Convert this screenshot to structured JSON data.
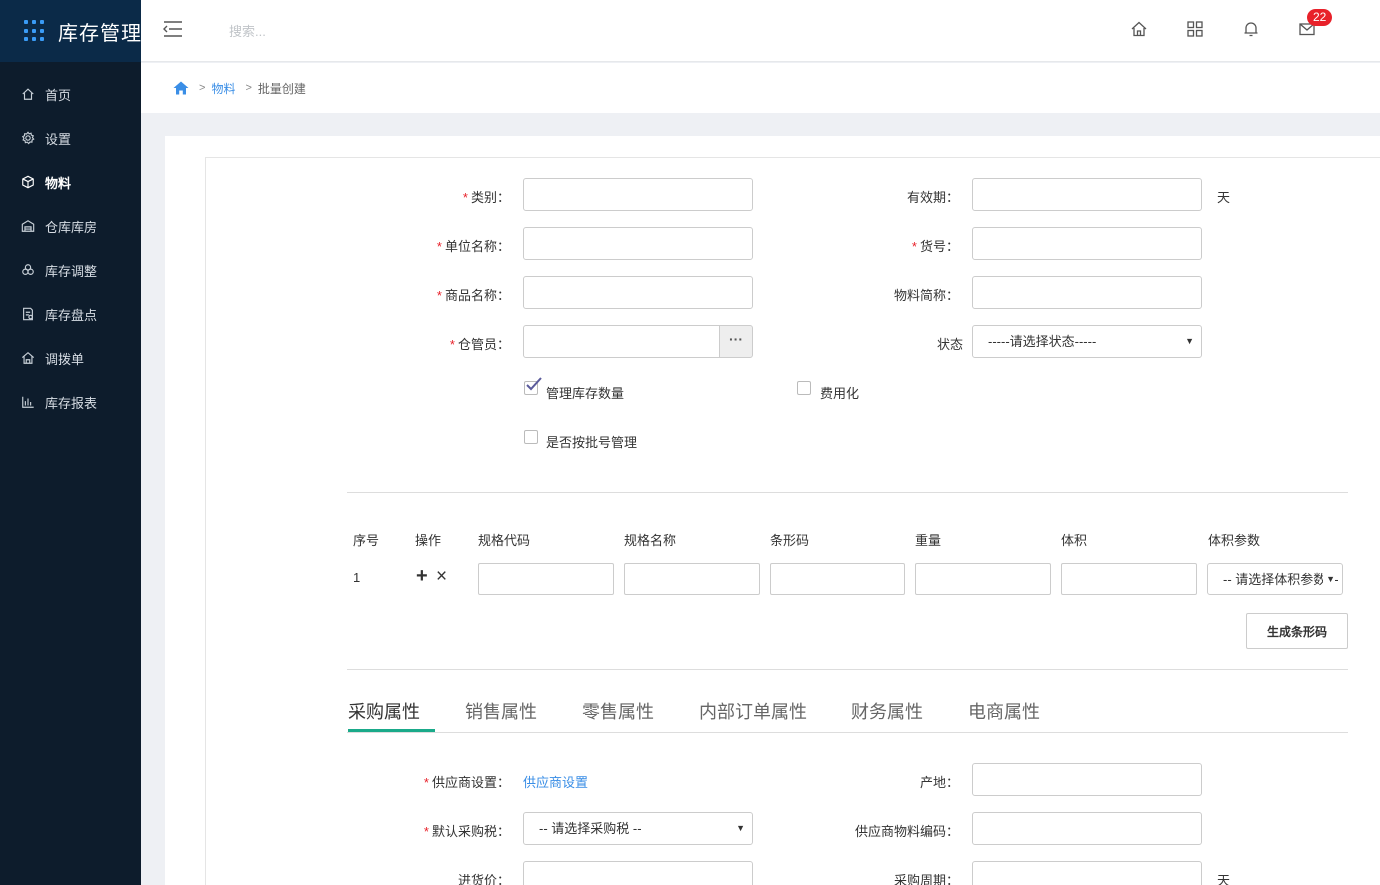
{
  "brand": {
    "title": "库存管理"
  },
  "sidebar": {
    "items": [
      {
        "label": "首页",
        "icon": "home-icon"
      },
      {
        "label": "设置",
        "icon": "gear-icon"
      },
      {
        "label": "物料",
        "icon": "cube-icon",
        "active": true
      },
      {
        "label": "仓库库房",
        "icon": "warehouse-icon"
      },
      {
        "label": "库存调整",
        "icon": "adjust-icon"
      },
      {
        "label": "库存盘点",
        "icon": "inventory-icon"
      },
      {
        "label": "调拨单",
        "icon": "transfer-icon"
      },
      {
        "label": "库存报表",
        "icon": "bar-chart-icon"
      }
    ]
  },
  "header": {
    "search_placeholder": "搜索...",
    "mail_badge": "22"
  },
  "breadcrumb": {
    "sep": ">",
    "parent": "物料",
    "current": "批量创建"
  },
  "form": {
    "category_label": "类别：",
    "unit_name_label": "单位名称：",
    "product_name_label": "商品名称：",
    "keeper_label": "仓管员：",
    "keeper_button": "···",
    "validity_label": "有效期：",
    "validity_unit": "天",
    "item_no_label": "货号：",
    "short_name_label": "物料简称：",
    "status_label": "状态",
    "status_value": "-----请选择状态-----",
    "manage_qty_label": "管理库存数量",
    "expense_label": "费用化",
    "batch_label": "是否按批号管理",
    "required_mark": "*"
  },
  "spec_table": {
    "headers": [
      "序号",
      "操作",
      "规格代码",
      "规格名称",
      "条形码",
      "重量",
      "体积",
      "体积参数"
    ],
    "rows": [
      {
        "index": "1",
        "add": "+",
        "remove": "×",
        "volume_param_value": "-- 请选择体积参数 --"
      }
    ],
    "generate_button": "生成条形码"
  },
  "tabs": [
    "采购属性",
    "销售属性",
    "零售属性",
    "内部订单属性",
    "财务属性",
    "电商属性"
  ],
  "purchase": {
    "supplier_label": "供应商设置：",
    "supplier_link": "供应商设置",
    "tax_label": "默认采购税：",
    "tax_value": "-- 请选择采购税 --",
    "price_label": "进货价：",
    "origin_label": "产地：",
    "supplier_code_label": "供应商物料编码：",
    "cycle_label": "采购周期：",
    "cycle_unit": "天"
  },
  "colors": {
    "accent": "#1aaa8a",
    "sidebar": "#0d1c2c",
    "brand_bg": "#0b2a48",
    "link": "#3a8ee6",
    "badge": "#e8212a"
  }
}
